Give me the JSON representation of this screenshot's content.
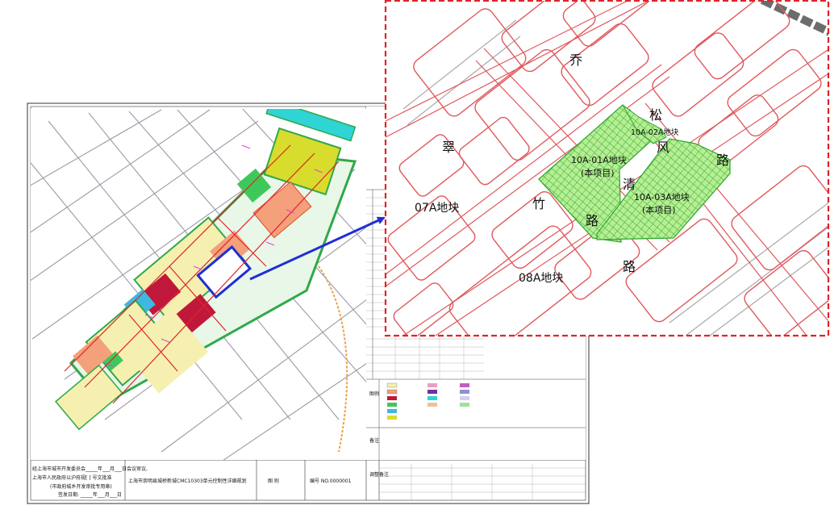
{
  "inset": {
    "road_chars": {
      "qiao": "乔",
      "song": "松",
      "cui": "翠",
      "feng": "风",
      "qing": "清",
      "zhu": "竹",
      "lu1": "路",
      "lu2": "路",
      "lu3": "路"
    },
    "plot_07a": "07A地块",
    "plot_08a": "08A地块",
    "plot_10a02": "10A-02A地块",
    "plot_10a01": "10A-01A地块",
    "plot_10a01_note": "(本项目)",
    "plot_10a03": "10A-03A地块",
    "plot_10a03_note": "(本项目)"
  },
  "plan": {
    "title": "上海市崇明县城桥新城CMC10303单元控制性详细规划",
    "drawing_label": "图  则",
    "number_label": "编号 NO.0000001",
    "approval_line1": "经上海市城市开发委员会_____年___月___日会议审议,",
    "approval_line2": "上海市人民政府以沪府规[      ]        号文批准",
    "approval_line3": "(市政府城乡开发审批专用章)",
    "approval_line4": "签发日期: _____年___月___日",
    "side_labels": {
      "legend": "图例",
      "notes": "备注",
      "adjust": "调整备注"
    }
  },
  "colors": {
    "inset_border": "#e0242a",
    "road_line": "#e0585c",
    "project_fill": "#b6ee93",
    "project_hatch": "#2fa52f",
    "arrow": "#1f2fd6",
    "residential": "#f5f0b0",
    "commercial": "#f4a07a",
    "green": "#3fc85a",
    "public": "#c0183a",
    "yellow_zone": "#d8dc2c"
  }
}
